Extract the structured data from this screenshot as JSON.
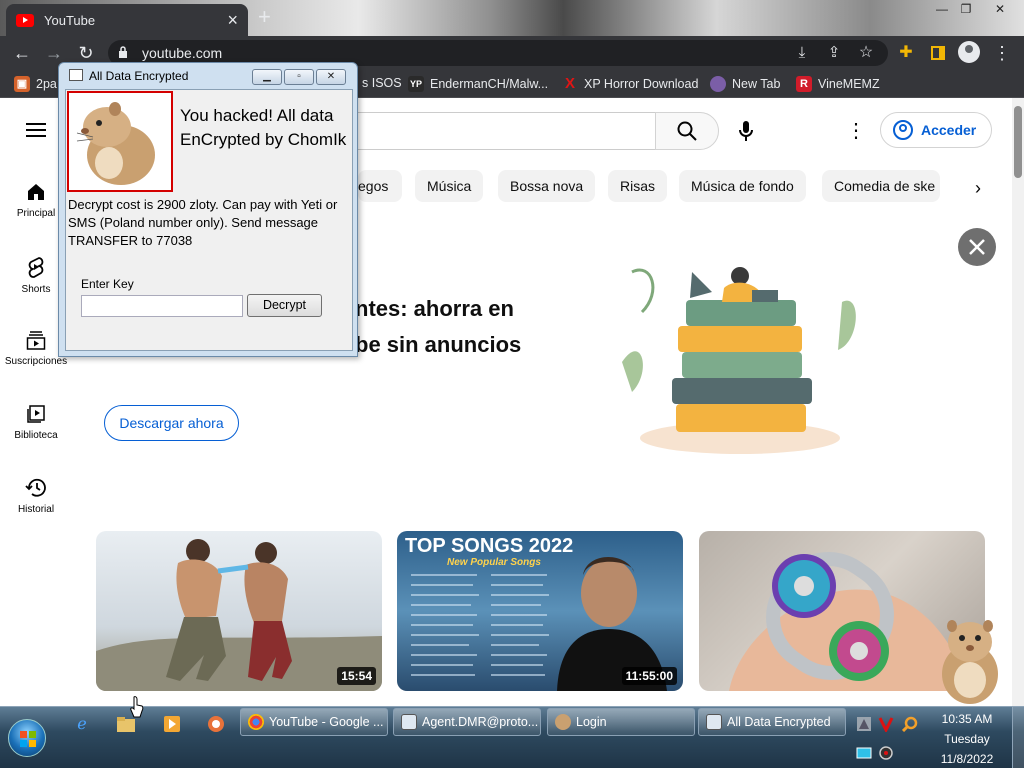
{
  "browser": {
    "tab_title": "YouTube",
    "url": "youtube.com",
    "new_tab": "+",
    "close_tab": "×"
  },
  "bookmarks": [
    {
      "label": "2pa",
      "icon": "bag-icon",
      "color": "#d4622b"
    },
    {
      "label": "s ISOS",
      "icon": "",
      "color": ""
    },
    {
      "label": "EndermanCH/Malw...",
      "icon": "YP",
      "color": "#2a2a2a"
    },
    {
      "label": "XP Horror Download",
      "icon": "X",
      "color": "#e01515"
    },
    {
      "label": "New Tab",
      "icon": "globe-icon",
      "color": "#7b5ea7"
    },
    {
      "label": "VineMEMZ",
      "icon": "R",
      "color": "#d11c2a"
    }
  ],
  "youtube": {
    "signin": "Acceder",
    "sidebar": [
      {
        "label": "Principal",
        "icon": "home-icon"
      },
      {
        "label": "Shorts",
        "icon": "shorts-icon"
      },
      {
        "label": "Suscripciones",
        "icon": "subscriptions-icon"
      },
      {
        "label": "Biblioteca",
        "icon": "library-icon"
      },
      {
        "label": "Historial",
        "icon": "history-icon"
      }
    ],
    "chips": [
      "egos",
      "Música",
      "Bossa nova",
      "Risas",
      "Música de fondo",
      "Comedia de ske"
    ],
    "banner": {
      "line1": "ntes: ahorra en",
      "line2": "be sin anuncios",
      "button": "Descargar ahora"
    },
    "videos": [
      {
        "duration": "15:54",
        "title_overlay": ""
      },
      {
        "duration": "11:55:00",
        "title_overlay": "TOP SONGS 2022",
        "subtitle_overlay": "New Popular Songs"
      },
      {
        "duration": "",
        "title_overlay": ""
      }
    ]
  },
  "popup": {
    "title": "All Data Encrypted",
    "headline": "You hacked! All data EnCrypted by ChomIk",
    "message": "Decrypt cost is 2900 zloty. Can pay with Yeti or SMS (Poland number only). Send message TRANSFER to 77038",
    "key_label": "Enter Key",
    "key_value": "",
    "decrypt_button": "Decrypt"
  },
  "taskbar": {
    "buttons": [
      {
        "label": "YouTube - Google ...",
        "icon": "chrome-icon"
      },
      {
        "label": "Agent.DMR@proto...",
        "icon": "window-icon"
      },
      {
        "label": "Login",
        "icon": "hamster-icon"
      },
      {
        "label": "All Data Encrypted",
        "icon": "window-icon"
      }
    ],
    "time": "10:35 AM",
    "day": "Tuesday",
    "date": "11/8/2022"
  }
}
